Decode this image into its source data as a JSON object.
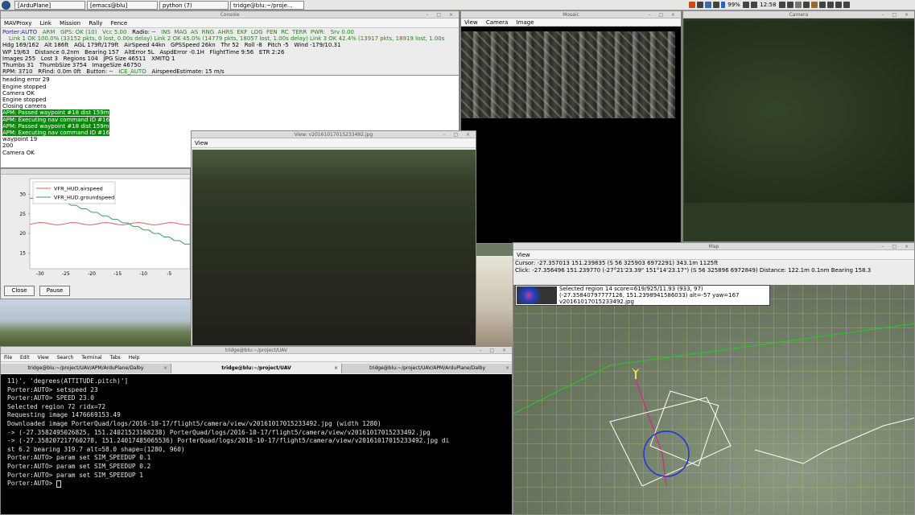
{
  "taskbar": {
    "tasks": [
      "[ArduPlane]",
      "[emacs@blu]",
      "python (7)",
      "tridge@blu:~/proje..."
    ],
    "battery": "99%",
    "clock": "12:58"
  },
  "console": {
    "title": "Console",
    "menu": [
      "MAVProxy",
      "Link",
      "Mission",
      "Rally",
      "Fence"
    ],
    "status_row1": [
      "Porter:AUTO",
      "ARM",
      "GPS: OK (10)",
      "Vcc 5.00",
      "Radio: --",
      "INS",
      "MAG",
      "AS",
      "RNG",
      "AHRS",
      "EKF",
      "LOG",
      "FEN",
      "RC",
      "TERR",
      "PWR:",
      "Srv 0.00"
    ],
    "status_row2": "Link 1 OK 100.0% (33152 pkts, 0 lost, 0.00s delay)    Link 2 OK 45.0% (14779 pkts, 18057 lost, 1.00s delay)    Link 3 OK 42.4% (13917 pkts, 18919 lost, 1.00s",
    "status_row3": [
      "Hdg 169/162",
      "Alt 186ft",
      "AGL 179ft/179ft",
      "AirSpeed 44kn",
      "GPSSpeed 26kn",
      "Thr 52",
      "Roll -8",
      "Pitch -5",
      "Wind -179/10.31"
    ],
    "status_row4": [
      "WP 19/63",
      "Distance 0.2nm",
      "Bearing 157",
      "AltError 5L",
      "AspdError -0.1H",
      "FlightTime 9:56",
      "ETR 2:26"
    ],
    "status_row5": [
      "Images 255",
      "Lost 3",
      "Regions 104",
      "JPG Size 46511",
      "XMITQ 1"
    ],
    "status_row6": [
      "Thumbs 31",
      "ThumbSize 3754",
      "ImageSize 46750"
    ],
    "status_row7": [
      "RPM: 3710",
      "RFind: 0.0m 0ft",
      "Button: --",
      "ICE_AUTO",
      "AirspeedEstimate: 15 m/s"
    ],
    "log": [
      {
        "text": "heading error 29",
        "hl": false
      },
      {
        "text": "Engine stopped",
        "hl": false
      },
      {
        "text": "Camera OK",
        "hl": false
      },
      {
        "text": "Engine stopped",
        "hl": false
      },
      {
        "text": "Closing camera",
        "hl": false
      },
      {
        "text": "APM: Passed waypoint #18 dist 159m",
        "hl": true
      },
      {
        "text": "APM: Executing nav command ID #16",
        "hl": true
      },
      {
        "text": "APM: Passed waypoint #18 dist 159m",
        "hl": true
      },
      {
        "text": "APM: Executing nav command ID #16",
        "hl": true
      },
      {
        "text": "waypoint 19",
        "hl": false
      },
      {
        "text": "200",
        "hl": false
      },
      {
        "text": "Camera OK",
        "hl": false
      }
    ]
  },
  "graph": {
    "legend": [
      "VFR_HUD.airspeed",
      "VFR_HUD.groundspeed"
    ],
    "y_ticks": [
      "30",
      "25",
      "20",
      "15"
    ],
    "x_ticks": [
      "-30",
      "-25",
      "-20",
      "-15",
      "-10",
      "-5"
    ],
    "close_label": "Close",
    "pause_label": "Pause",
    "colors": {
      "airspeed": "#e06060",
      "groundspeed": "#3c9a6a"
    }
  },
  "mosaic": {
    "title": "Mosaic",
    "menu": [
      "View",
      "Camera",
      "Image"
    ]
  },
  "camera": {
    "title": "Camera"
  },
  "image_view": {
    "title": "View: v20161017015233492.jpg",
    "menu": [
      "View"
    ]
  },
  "map": {
    "title": "Map",
    "menu": [
      "View"
    ],
    "cursor_line": "Cursor: -27.357013 151.239835 (S 56 325903 6972291) 343.1m 1125ft",
    "click_line": "Click: -27.356496 151.239770 (-27°21'23.39\" 151°14'23.17\") (S 56 325896 6972849)  Distance: 122.1m 0.1nm Bearing 158.3",
    "info": [
      "Selected region 14 score=619/925/11.93 (933, 97)",
      "(-27.35840797777126, 151.2398941586033) alt=-57 yaw=167",
      "v20161017015233492.jpg"
    ]
  },
  "terminal": {
    "title": "tridge@blu:~/project/UAV",
    "menu": [
      "File",
      "Edit",
      "View",
      "Search",
      "Terminal",
      "Tabs",
      "Help"
    ],
    "tabs": [
      "tridge@blu:~/project/UAV/APM/ArduPlane/Dalby",
      "tridge@blu:~/project/UAV",
      "tridge@blu:~/project/UAV/APM/ArduPlane/Dalby"
    ],
    "lines": [
      "11)', 'degrees(ATTITUDE.pitch)']",
      "",
      "Porter:AUTO> setspeed 23",
      "Porter:AUTO> SPEED 23.0",
      "Selected region 72 ridx=72",
      "Requesting image 1476669153.49",
      "Downloaded image PorterQuad/logs/2016-10-17/flight5/camera/view/v20161017015233492.jpg (width 1280)",
      "-> (-27.3582495026825, 151.24021523168238) PorterQuad/logs/2016-10-17/flight5/camera/view/v20161017015233492.jpg",
      "-> (-27.358207217760278, 151.24017485065536) PorterQuad/logs/2016-10-17/flight5/camera/view/v20161017015233492.jpg di",
      "st 6.2 bearing 319.7 alt=58.0 shape=(1280, 960)",
      "",
      "Porter:AUTO> param set SIM_SPEEDUP 0.1",
      "Porter:AUTO> param set SIM_SPEEDUP 0.2",
      "Porter:AUTO> param set SIM_SPEEDUP 1",
      "Porter:AUTO> "
    ]
  }
}
